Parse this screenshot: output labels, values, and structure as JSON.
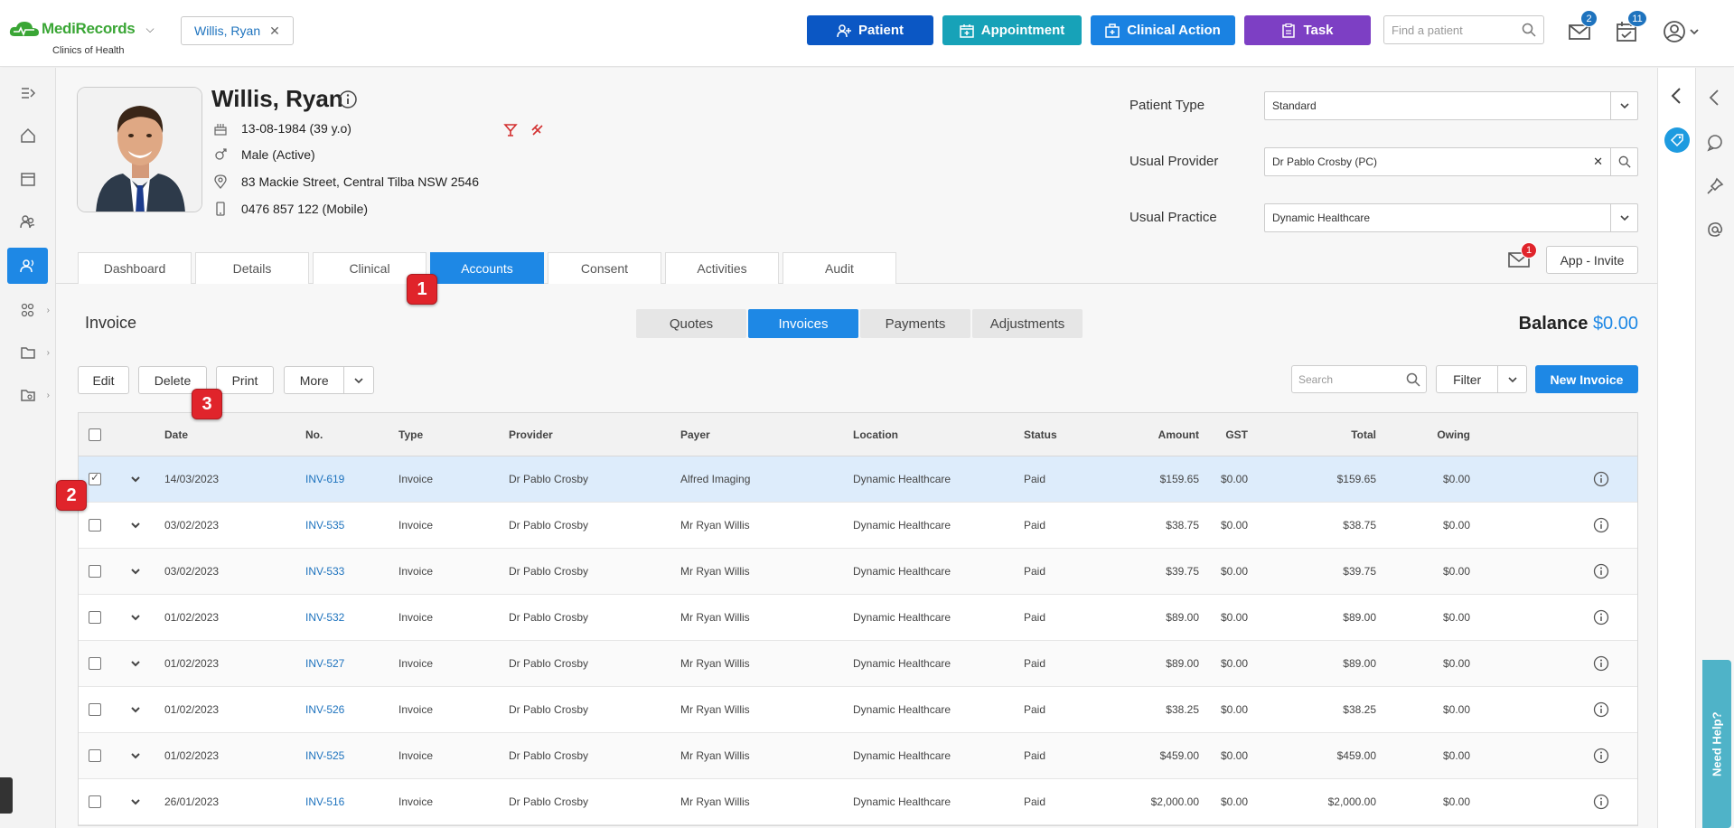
{
  "brand": {
    "name_part1": "Medi",
    "name_part2": "Records",
    "subtitle": "Clinics of Health"
  },
  "patient_chip": {
    "label": "Willis, Ryan"
  },
  "top_actions": [
    {
      "label": "Patient",
      "color": "#0b57c4"
    },
    {
      "label": "Appointment",
      "color": "#17a2b8"
    },
    {
      "label": "Clinical Action",
      "color": "#1a82e2"
    },
    {
      "label": "Task",
      "color": "#7d3fc4"
    }
  ],
  "find_patient": {
    "placeholder": "Find a patient"
  },
  "notifications": {
    "messages": "2",
    "tasks": "11"
  },
  "patient": {
    "name": "Willis, Ryan",
    "dob": "13-08-1984 (39 y.o)",
    "gender": "Male (Active)",
    "address": "83 Mackie Street, Central Tilba NSW 2546",
    "phone": "0476 857 122 (Mobile)"
  },
  "patient_fields": {
    "type_label": "Patient Type",
    "type_value": "Standard",
    "provider_label": "Usual Provider",
    "provider_value": "Dr Pablo Crosby (PC)",
    "practice_label": "Usual Practice",
    "practice_value": "Dynamic Healthcare"
  },
  "patient_tabs": [
    "Dashboard",
    "Details",
    "Clinical",
    "Accounts",
    "Consent",
    "Activities",
    "Audit"
  ],
  "active_patient_tab": "Accounts",
  "mail_badge": "1",
  "app_invite": "App - Invite",
  "invoice": {
    "title": "Invoice",
    "subtabs": [
      "Quotes",
      "Invoices",
      "Payments",
      "Adjustments"
    ],
    "balance_label": "Balance",
    "balance_value": "$0.00",
    "actions": {
      "edit": "Edit",
      "delete": "Delete",
      "print": "Print",
      "more": "More",
      "filter": "Filter",
      "new": "New Invoice"
    },
    "search_placeholder": "Search"
  },
  "table": {
    "headers": [
      "Date",
      "No.",
      "Type",
      "Provider",
      "Payer",
      "Location",
      "Status",
      "Amount",
      "GST",
      "Total",
      "Owing"
    ],
    "rows": [
      {
        "date": "14/03/2023",
        "no": "INV-619",
        "type": "Invoice",
        "provider": "Dr Pablo Crosby",
        "payer": "Alfred Imaging",
        "location": "Dynamic Healthcare",
        "status": "Paid",
        "amount": "$159.65",
        "gst": "$0.00",
        "total": "$159.65",
        "owing": "$0.00",
        "selected": true
      },
      {
        "date": "03/02/2023",
        "no": "INV-535",
        "type": "Invoice",
        "provider": "Dr Pablo Crosby",
        "payer": "Mr Ryan Willis",
        "location": "Dynamic Healthcare",
        "status": "Paid",
        "amount": "$38.75",
        "gst": "$0.00",
        "total": "$38.75",
        "owing": "$0.00",
        "selected": false
      },
      {
        "date": "03/02/2023",
        "no": "INV-533",
        "type": "Invoice",
        "provider": "Dr Pablo Crosby",
        "payer": "Mr Ryan Willis",
        "location": "Dynamic Healthcare",
        "status": "Paid",
        "amount": "$39.75",
        "gst": "$0.00",
        "total": "$39.75",
        "owing": "$0.00",
        "selected": false
      },
      {
        "date": "01/02/2023",
        "no": "INV-532",
        "type": "Invoice",
        "provider": "Dr Pablo Crosby",
        "payer": "Mr Ryan Willis",
        "location": "Dynamic Healthcare",
        "status": "Paid",
        "amount": "$89.00",
        "gst": "$0.00",
        "total": "$89.00",
        "owing": "$0.00",
        "selected": false
      },
      {
        "date": "01/02/2023",
        "no": "INV-527",
        "type": "Invoice",
        "provider": "Dr Pablo Crosby",
        "payer": "Mr Ryan Willis",
        "location": "Dynamic Healthcare",
        "status": "Paid",
        "amount": "$89.00",
        "gst": "$0.00",
        "total": "$89.00",
        "owing": "$0.00",
        "selected": false
      },
      {
        "date": "01/02/2023",
        "no": "INV-526",
        "type": "Invoice",
        "provider": "Dr Pablo Crosby",
        "payer": "Mr Ryan Willis",
        "location": "Dynamic Healthcare",
        "status": "Paid",
        "amount": "$38.25",
        "gst": "$0.00",
        "total": "$38.25",
        "owing": "$0.00",
        "selected": false
      },
      {
        "date": "01/02/2023",
        "no": "INV-525",
        "type": "Invoice",
        "provider": "Dr Pablo Crosby",
        "payer": "Mr Ryan Willis",
        "location": "Dynamic Healthcare",
        "status": "Paid",
        "amount": "$459.00",
        "gst": "$0.00",
        "total": "$459.00",
        "owing": "$0.00",
        "selected": false
      },
      {
        "date": "26/01/2023",
        "no": "INV-516",
        "type": "Invoice",
        "provider": "Dr Pablo Crosby",
        "payer": "Mr Ryan Willis",
        "location": "Dynamic Healthcare",
        "status": "Paid",
        "amount": "$2,000.00",
        "gst": "$0.00",
        "total": "$2,000.00",
        "owing": "$0.00",
        "selected": false
      }
    ]
  },
  "step_markers": [
    "1",
    "2",
    "3"
  ],
  "need_help": "Need Help?"
}
